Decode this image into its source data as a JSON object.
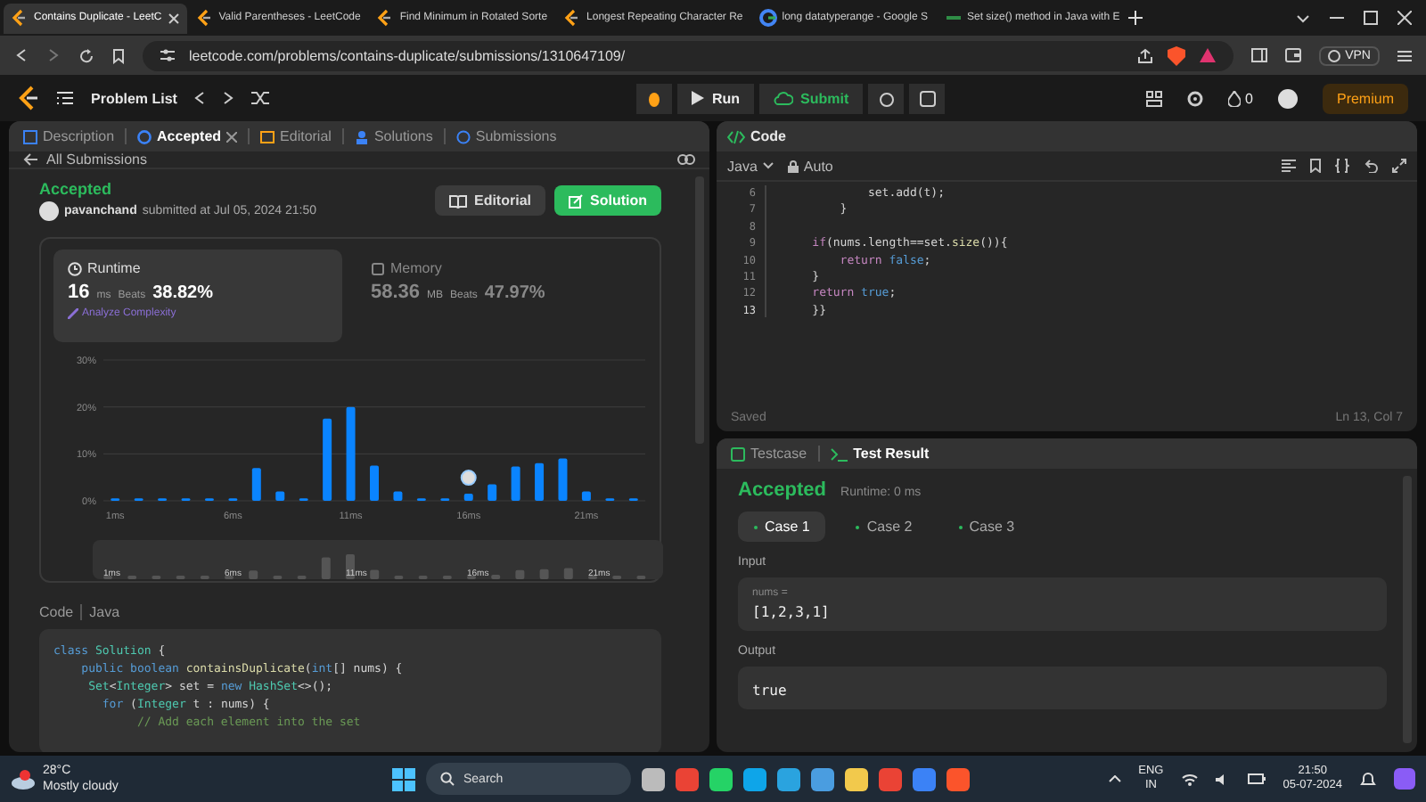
{
  "browser_tabs": [
    {
      "title": "Contains Duplicate - LeetC",
      "selected": true
    },
    {
      "title": "Valid Parentheses - LeetCode",
      "selected": false
    },
    {
      "title": "Find Minimum in Rotated Sorte",
      "selected": false
    },
    {
      "title": "Longest Repeating Character Re",
      "selected": false
    },
    {
      "title": "long datatyperange - Google S",
      "selected": false
    },
    {
      "title": "Set size() method in Java with E",
      "selected": false
    }
  ],
  "address": "leetcode.com/problems/contains-duplicate/submissions/1310647109/",
  "vpn": "VPN",
  "nav": {
    "problem_list": "Problem List",
    "run": "Run",
    "submit": "Submit",
    "streak": "0",
    "premium": "Premium"
  },
  "left_tabs": [
    {
      "label": "Description",
      "selected": false
    },
    {
      "label": "Accepted",
      "selected": true,
      "closable": true
    },
    {
      "label": "Editorial",
      "selected": false
    },
    {
      "label": "Solutions",
      "selected": false
    },
    {
      "label": "Submissions",
      "selected": false
    }
  ],
  "back_link": "All Submissions",
  "submission": {
    "status": "Accepted",
    "user": "pavanchand",
    "submitted": "submitted at Jul 05, 2024 21:50",
    "buttons": [
      "Editorial",
      "Solution"
    ]
  },
  "stats": [
    {
      "label": "Runtime",
      "value": "16",
      "unit": "ms",
      "beats_label": "Beats",
      "beats": "38.82%",
      "link": "Analyze Complexity",
      "selected": true
    },
    {
      "label": "Memory",
      "value": "58.36",
      "unit": "MB",
      "beats_label": "Beats",
      "beats": "47.97%",
      "selected": false
    }
  ],
  "chart_data": {
    "type": "bar",
    "x": [
      1,
      2,
      3,
      4,
      5,
      6,
      7,
      8,
      9,
      10,
      11,
      12,
      13,
      14,
      15,
      16,
      17,
      18,
      19,
      20,
      21,
      22,
      23
    ],
    "series": [
      {
        "color": "#0a84ff",
        "values": [
          0.5,
          0.5,
          0.5,
          0.5,
          0.5,
          0.5,
          7,
          2,
          0.5,
          17.5,
          20,
          7.5,
          2,
          0.5,
          0.5,
          1.5,
          3.5,
          7.3,
          8,
          9,
          2,
          0.5,
          0.5
        ]
      }
    ],
    "xlim": [
      0.5,
      23.5
    ],
    "ylim": [
      0,
      30
    ],
    "yticks": [
      {
        "value": 0,
        "label": "0%"
      },
      {
        "value": 10,
        "label": "10%"
      },
      {
        "value": 20,
        "label": "20%"
      },
      {
        "value": 30,
        "label": "30%"
      }
    ],
    "xticks": [
      {
        "value": 1,
        "label": "1ms"
      },
      {
        "value": 6,
        "label": "6ms"
      },
      {
        "value": 11,
        "label": "11ms"
      },
      {
        "value": 16,
        "label": "16ms"
      },
      {
        "value": 21,
        "label": "21ms"
      }
    ]
  },
  "navigator_labels": [
    "1ms",
    "6ms",
    "11ms",
    "16ms",
    "21ms"
  ],
  "code_header": {
    "title": "Code",
    "language": "Java"
  },
  "code_lines": [
    [
      {
        "text": "class ",
        "kind": "kw"
      },
      {
        "text": "Solution",
        "kind": "type"
      },
      {
        "text": " {",
        "kind": "tx"
      }
    ],
    [
      {
        "text": "    public boolean ",
        "kind": "kw"
      },
      {
        "text": "containsDuplicate",
        "kind": "fn"
      },
      {
        "text": "(",
        "kind": "tx"
      },
      {
        "text": "int",
        "kind": "kw"
      },
      {
        "text": "[] nums) {",
        "kind": "tx"
      }
    ],
    [
      {
        "text": "     Set",
        "kind": "type"
      },
      {
        "text": "<",
        "kind": "tx"
      },
      {
        "text": "Integer",
        "kind": "type"
      },
      {
        "text": "> set = ",
        "kind": "tx"
      },
      {
        "text": "new ",
        "kind": "kw"
      },
      {
        "text": "HashSet",
        "kind": "type"
      },
      {
        "text": "<>();",
        "kind": "tx"
      }
    ],
    [
      {
        "text": "       for",
        "kind": "kw"
      },
      {
        "text": " (",
        "kind": "tx"
      },
      {
        "text": "Integer",
        "kind": "type"
      },
      {
        "text": " t : nums) {",
        "kind": "tx"
      }
    ],
    [
      {
        "text": "            // Add each element into the set",
        "kind": "cm"
      }
    ]
  ],
  "editor": {
    "title": "Code",
    "language": "Java",
    "mode": "Auto",
    "status": "Saved",
    "position": "Ln 13, Col 7",
    "lines": [
      {
        "n": "6",
        "tokens": [
          {
            "text": "            set.add(t);",
            "kind": "tx"
          }
        ]
      },
      {
        "n": "7",
        "tokens": [
          {
            "text": "        }",
            "kind": "tx"
          }
        ]
      },
      {
        "n": "8"
      },
      {
        "n": "9",
        "tokens": [
          {
            "text": "    if",
            "kind": "ctl"
          },
          {
            "text": "(nums.length==set.",
            "kind": "tx"
          },
          {
            "text": "size",
            "kind": "fn"
          },
          {
            "text": "()){",
            "kind": "tx"
          }
        ]
      },
      {
        "n": "10",
        "tokens": [
          {
            "text": "        return ",
            "kind": "ctl"
          },
          {
            "text": "false",
            "kind": "kw"
          },
          {
            "text": ";",
            "kind": "tx"
          }
        ]
      },
      {
        "n": "11",
        "tokens": [
          {
            "text": "    }",
            "kind": "tx"
          }
        ]
      },
      {
        "n": "12",
        "tokens": [
          {
            "text": "    return ",
            "kind": "ctl"
          },
          {
            "text": "true",
            "kind": "kw"
          },
          {
            "text": ";",
            "kind": "tx"
          }
        ]
      },
      {
        "n": "13",
        "tokens": [
          {
            "text": "    }}",
            "kind": "tx"
          }
        ]
      }
    ]
  },
  "test_tabs": [
    {
      "label": "Testcase",
      "selected": false
    },
    {
      "label": "Test Result",
      "selected": true
    }
  ],
  "result": {
    "status": "Accepted",
    "runtime": "Runtime: 0 ms",
    "cases": [
      {
        "label": "Case 1",
        "selected": true
      },
      {
        "label": "Case 2",
        "selected": false
      },
      {
        "label": "Case 3",
        "selected": false
      }
    ],
    "input_label": "Input",
    "var": "nums =",
    "input": "[1,2,3,1]",
    "output_label": "Output",
    "output": "true"
  },
  "taskbar": {
    "temp": "28°C",
    "weather": "Mostly cloudy",
    "search": "Search",
    "lang": "ENG",
    "region": "IN",
    "time": "21:50",
    "date": "05-07-2024"
  }
}
